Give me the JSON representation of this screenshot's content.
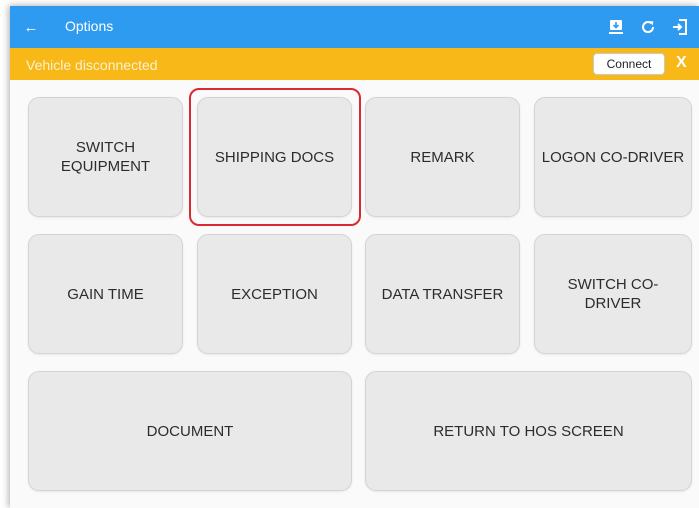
{
  "appbar": {
    "title": "Options",
    "back_icon": "arrow-left-icon",
    "icons": [
      "download-icon",
      "refresh-icon",
      "logout-icon"
    ]
  },
  "status": {
    "text": "Vehicle disconnected",
    "connect_label": "Connect",
    "close_label": "X"
  },
  "tiles": {
    "switch_equipment": "SWITCH\nEQUIPMENT",
    "shipping_docs": "SHIPPING DOCS",
    "remark": "REMARK",
    "logon_codriver": "LOGON CO-DRIVER",
    "gain_time": "GAIN TIME",
    "exception": "EXCEPTION",
    "data_transfer": "DATA TRANSFER",
    "switch_codriver": "SWITCH CO-\nDRIVER",
    "document": "DOCUMENT",
    "return_hos": "RETURN TO HOS SCREEN"
  },
  "colors": {
    "appbar": "#2e9bf0",
    "status_bar": "#f7b818",
    "tile": "#e9e9e9",
    "highlight": "#d92a34"
  }
}
